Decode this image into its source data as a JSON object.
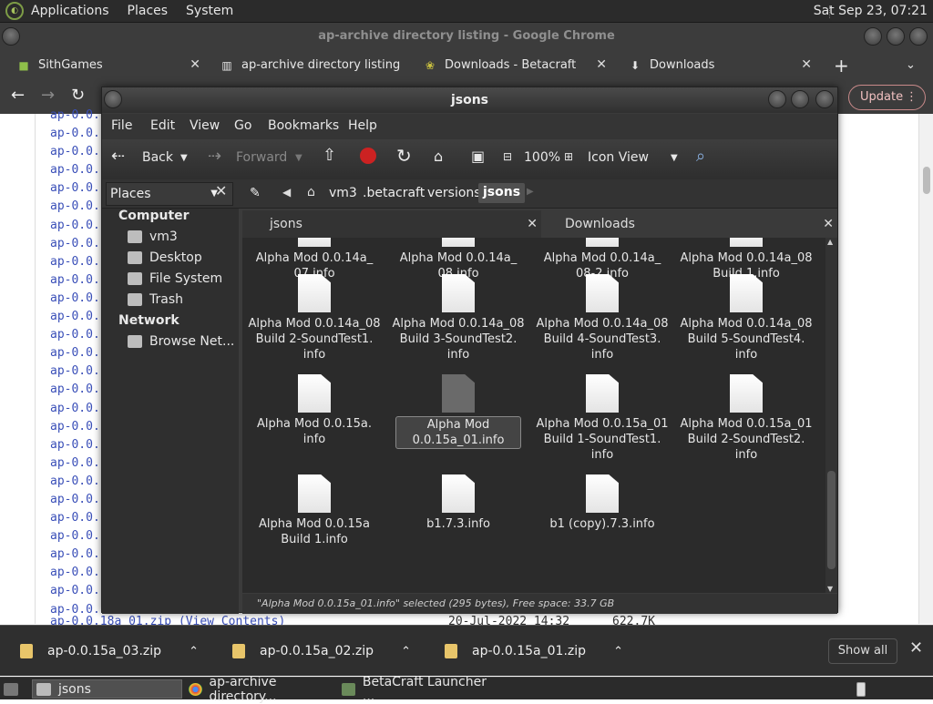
{
  "topbar": {
    "menus": [
      "Applications",
      "Places",
      "System"
    ],
    "clock": "Sat Sep 23, 07:21"
  },
  "chrome": {
    "title": "ap-archive directory listing - Google Chrome",
    "tabs": [
      {
        "label": "SithGames",
        "icon": "cube-icon"
      },
      {
        "label": "ap-archive directory listing",
        "icon": "archive-icon"
      },
      {
        "label": "Downloads - Betacraft",
        "icon": "leaf-icon"
      },
      {
        "label": "Downloads",
        "icon": "download-icon"
      }
    ],
    "new_tab": "+",
    "update_label": "Update"
  },
  "page": {
    "line_prefix": "ap-0.0.",
    "bottom_link": "ap-0.0.18a_01.zip (View Contents)",
    "bottom_meta": "20-Jul-2022 14:32      622.7K"
  },
  "fm": {
    "title": "jsons",
    "menu": [
      "File",
      "Edit",
      "View",
      "Go",
      "Bookmarks",
      "Help"
    ],
    "toolbar": {
      "back": "Back",
      "forward": "Forward",
      "zoom": "100%",
      "view": "Icon View"
    },
    "breadcrumb": [
      "vm3",
      ".betacraft",
      "versions",
      "jsons"
    ],
    "places_label": "Places",
    "sidebar": {
      "computer": "Computer",
      "items": [
        "vm3",
        "Desktop",
        "File System",
        "Trash"
      ],
      "network": "Network",
      "net_items": [
        "Browse Net..."
      ]
    },
    "pane_tabs": [
      "jsons",
      "Downloads"
    ],
    "files": [
      "Alpha Mod 0.0.14a_\n07.info",
      "Alpha Mod 0.0.14a_\n08.info",
      "Alpha Mod 0.0.14a_\n08-2.info",
      "Alpha Mod 0.0.14a_08\nBuild 1.info",
      "Alpha Mod 0.0.14a_08\nBuild 2-SoundTest1.\ninfo",
      "Alpha Mod 0.0.14a_08\nBuild 3-SoundTest2.\ninfo",
      "Alpha Mod 0.0.14a_08\nBuild 4-SoundTest3.\ninfo",
      "Alpha Mod 0.0.14a_08\nBuild 5-SoundTest4.\ninfo",
      "Alpha Mod 0.0.15a.\ninfo",
      "Alpha Mod\n0.0.15a_01.info",
      "Alpha Mod 0.0.15a_01\nBuild 1-SoundTest1.\ninfo",
      "Alpha Mod 0.0.15a_01\nBuild 2-SoundTest2.\ninfo",
      "Alpha Mod 0.0.15a\nBuild 1.info",
      "b1.7.3.info",
      "b1 (copy).7.3.info"
    ],
    "status": "\"Alpha Mod 0.0.15a_01.info\" selected (295 bytes), Free space: 33.7 GB"
  },
  "downloads": {
    "items": [
      "ap-0.0.15a_03.zip",
      "ap-0.0.15a_02.zip",
      "ap-0.0.15a_01.zip"
    ],
    "show_all": "Show all"
  },
  "taskbar": {
    "tasks": [
      "jsons",
      "ap-archive directory...",
      "BetaCraft Launcher ..."
    ]
  },
  "colors": {
    "accent": "#3a4fb8",
    "update": "#c98a8a",
    "folder": "#e8c56a"
  }
}
